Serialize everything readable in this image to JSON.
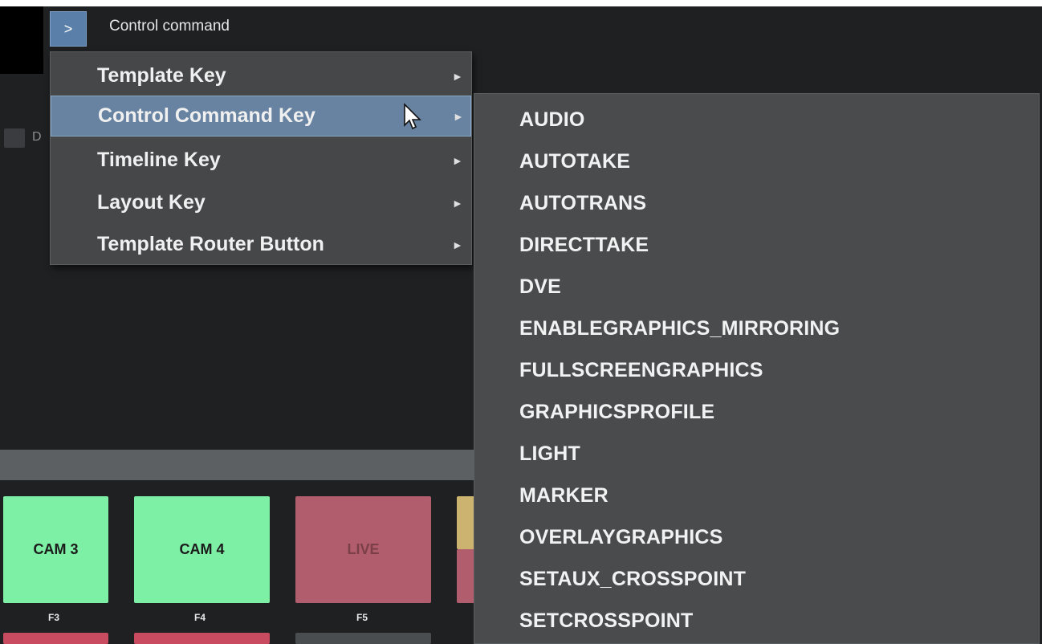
{
  "header": {
    "toggle_label": ">",
    "title": "Control command"
  },
  "side": {
    "checkbox_label": "D"
  },
  "context_menu": {
    "items": [
      {
        "label": "Template Key"
      },
      {
        "label": "Control Command Key"
      },
      {
        "label": "Timeline Key"
      },
      {
        "label": "Layout Key"
      },
      {
        "label": "Template Router Button"
      }
    ],
    "arrow": "►"
  },
  "submenu": {
    "items": [
      "AUDIO",
      "AUTOTAKE",
      "AUTOTRANS",
      "DIRECTTAKE",
      "DVE",
      "ENABLEGRAPHICS_MIRRORING",
      "FULLSCREENGRAPHICS",
      "GRAPHICSPROFILE",
      "LIGHT",
      "MARKER",
      "OVERLAYGRAPHICS",
      "SETAUX_CROSSPOINT",
      "SETCROSSPOINT"
    ]
  },
  "pads": [
    {
      "label": "CAM 3",
      "key": "F3"
    },
    {
      "label": "CAM 4",
      "key": "F4"
    },
    {
      "label": "LIVE",
      "key": "F5"
    }
  ],
  "colors": {
    "selected": "#6783a1",
    "menu_bg": "#454749",
    "cam_green": "#7ef0a6",
    "live_red": "#b25d6d"
  }
}
